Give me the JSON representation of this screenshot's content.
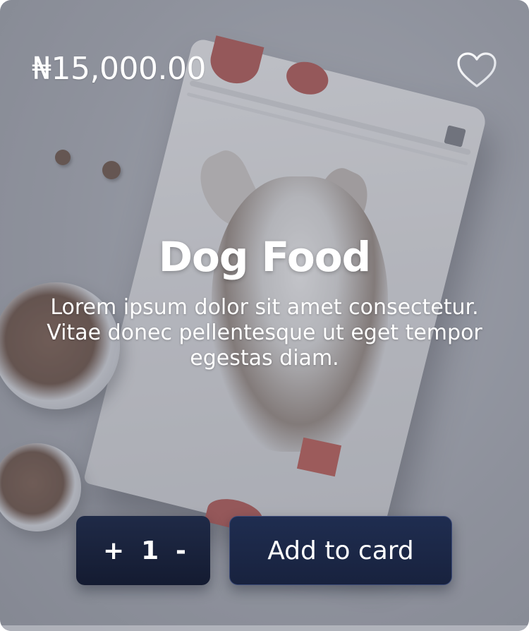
{
  "product": {
    "price": "₦15,000.00",
    "title": "Dog Food",
    "description": "Lorem ipsum dolor sit amet consectetur. Vitae donec pellentesque ut eget tempor egestas diam.",
    "favorite_icon": "heart-outline-icon"
  },
  "quantity": {
    "plus_label": "+",
    "value": "1",
    "minus_label": "-"
  },
  "actions": {
    "add_label": "Add to card"
  },
  "colors": {
    "button_bg": "#1a2440",
    "button_border": "#3b4a78",
    "text": "#ffffff",
    "accent_red": "#a8443f"
  }
}
